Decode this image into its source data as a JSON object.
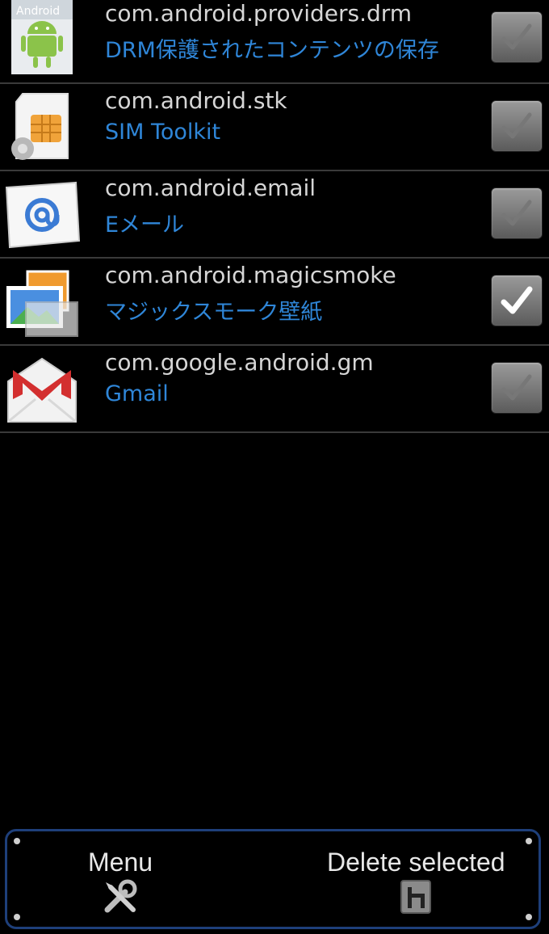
{
  "apps": [
    {
      "package": "com.android.providers.drm",
      "label": "DRM保護されたコンテンツの保存",
      "icon": "android-icon",
      "checked": false
    },
    {
      "package": "com.android.stk",
      "label": "SIM Toolkit",
      "icon": "sim-card-icon",
      "checked": false
    },
    {
      "package": "com.android.email",
      "label": "Eメール",
      "icon": "email-icon",
      "checked": false
    },
    {
      "package": "com.android.magicsmoke",
      "label": "マジックスモーク壁紙",
      "icon": "gallery-icon",
      "checked": true
    },
    {
      "package": "com.google.android.gm",
      "label": "Gmail",
      "icon": "gmail-icon",
      "checked": false
    }
  ],
  "android_icon_text": "Android",
  "bottom_bar": {
    "menu_label": "Menu",
    "menu_icon": "tools-icon",
    "delete_label": "Delete selected",
    "delete_icon": "delete-icon"
  },
  "colors": {
    "package_text": "#d6d6d6",
    "label_text": "#2f86d8",
    "bar_border": "#1e3f7a"
  }
}
